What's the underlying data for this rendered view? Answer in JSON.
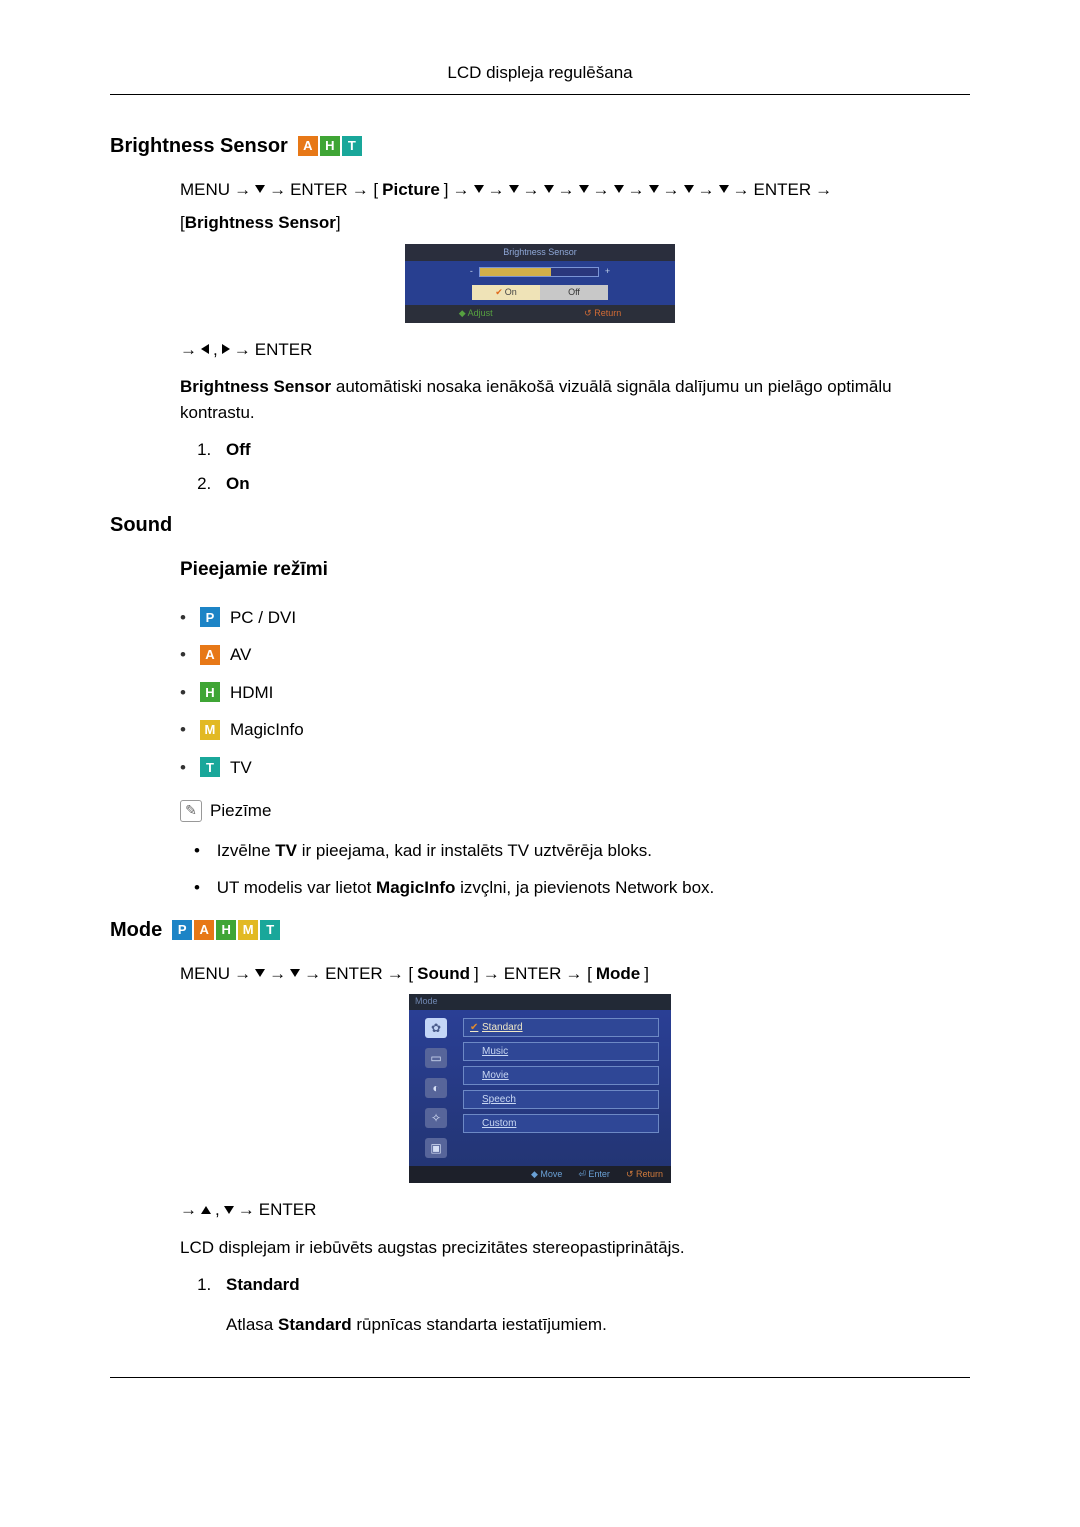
{
  "page_header": "LCD displeja regulēšana",
  "brightness": {
    "heading": "Brightness Sensor",
    "icons": [
      "A",
      "H",
      "T"
    ],
    "nav_prefix": "MENU",
    "nav_enter": "ENTER",
    "nav_picture": "Picture",
    "nav_suffix_label": "Brightness Sensor",
    "osd_title": "Brightness Sensor",
    "osd_minus": "-",
    "osd_plus": "+",
    "osd_on": "On",
    "osd_off": "Off",
    "osd_adjust": "Adjust",
    "osd_return": "Return",
    "post_nav_enter": "ENTER",
    "desc_b": "Brightness Sensor",
    "desc": " automātiski nosaka ienākošā vizuālā signāla dalījumu un pielāgo optimālu kontrastu.",
    "opts": {
      "off": "Off",
      "on": "On"
    }
  },
  "sound": {
    "heading": "Sound",
    "modes_heading": "Pieejamie režīmi",
    "items": [
      {
        "icon": "P",
        "label": "PC / DVI"
      },
      {
        "icon": "A",
        "label": "AV"
      },
      {
        "icon": "H",
        "label": "HDMI"
      },
      {
        "icon": "M",
        "label": "MagicInfo"
      },
      {
        "icon": "T",
        "label": "TV"
      }
    ],
    "note_label": "Piezīme",
    "notes": {
      "tv_pre": "Izvēlne ",
      "tv_b": "TV",
      "tv_post": " ir pieejama, kad ir instalēts TV uztvērēja bloks.",
      "mi_pre": "UT modelis var lietot ",
      "mi_b": "MagicInfo",
      "mi_post": " izvçlni, ja pievienots Network box."
    }
  },
  "mode": {
    "heading": "Mode",
    "icons": [
      "P",
      "A",
      "H",
      "M",
      "T"
    ],
    "nav_prefix": "MENU",
    "nav_enter": "ENTER",
    "nav_sound": "Sound",
    "nav_mode": "Mode",
    "osd_title": "Mode",
    "osd_items": [
      "Standard",
      "Music",
      "Movie",
      "Speech",
      "Custom"
    ],
    "osd_move": "Move",
    "osd_enter": "Enter",
    "osd_return": "Return",
    "post_nav_enter": "ENTER",
    "desc": "LCD displejam ir iebūvēts augstas precizitātes stereopastiprinātājs.",
    "std_label": "Standard",
    "std_pre": "Atlasa ",
    "std_b": "Standard",
    "std_post": " rūpnīcas standarta iestatījumiem."
  }
}
